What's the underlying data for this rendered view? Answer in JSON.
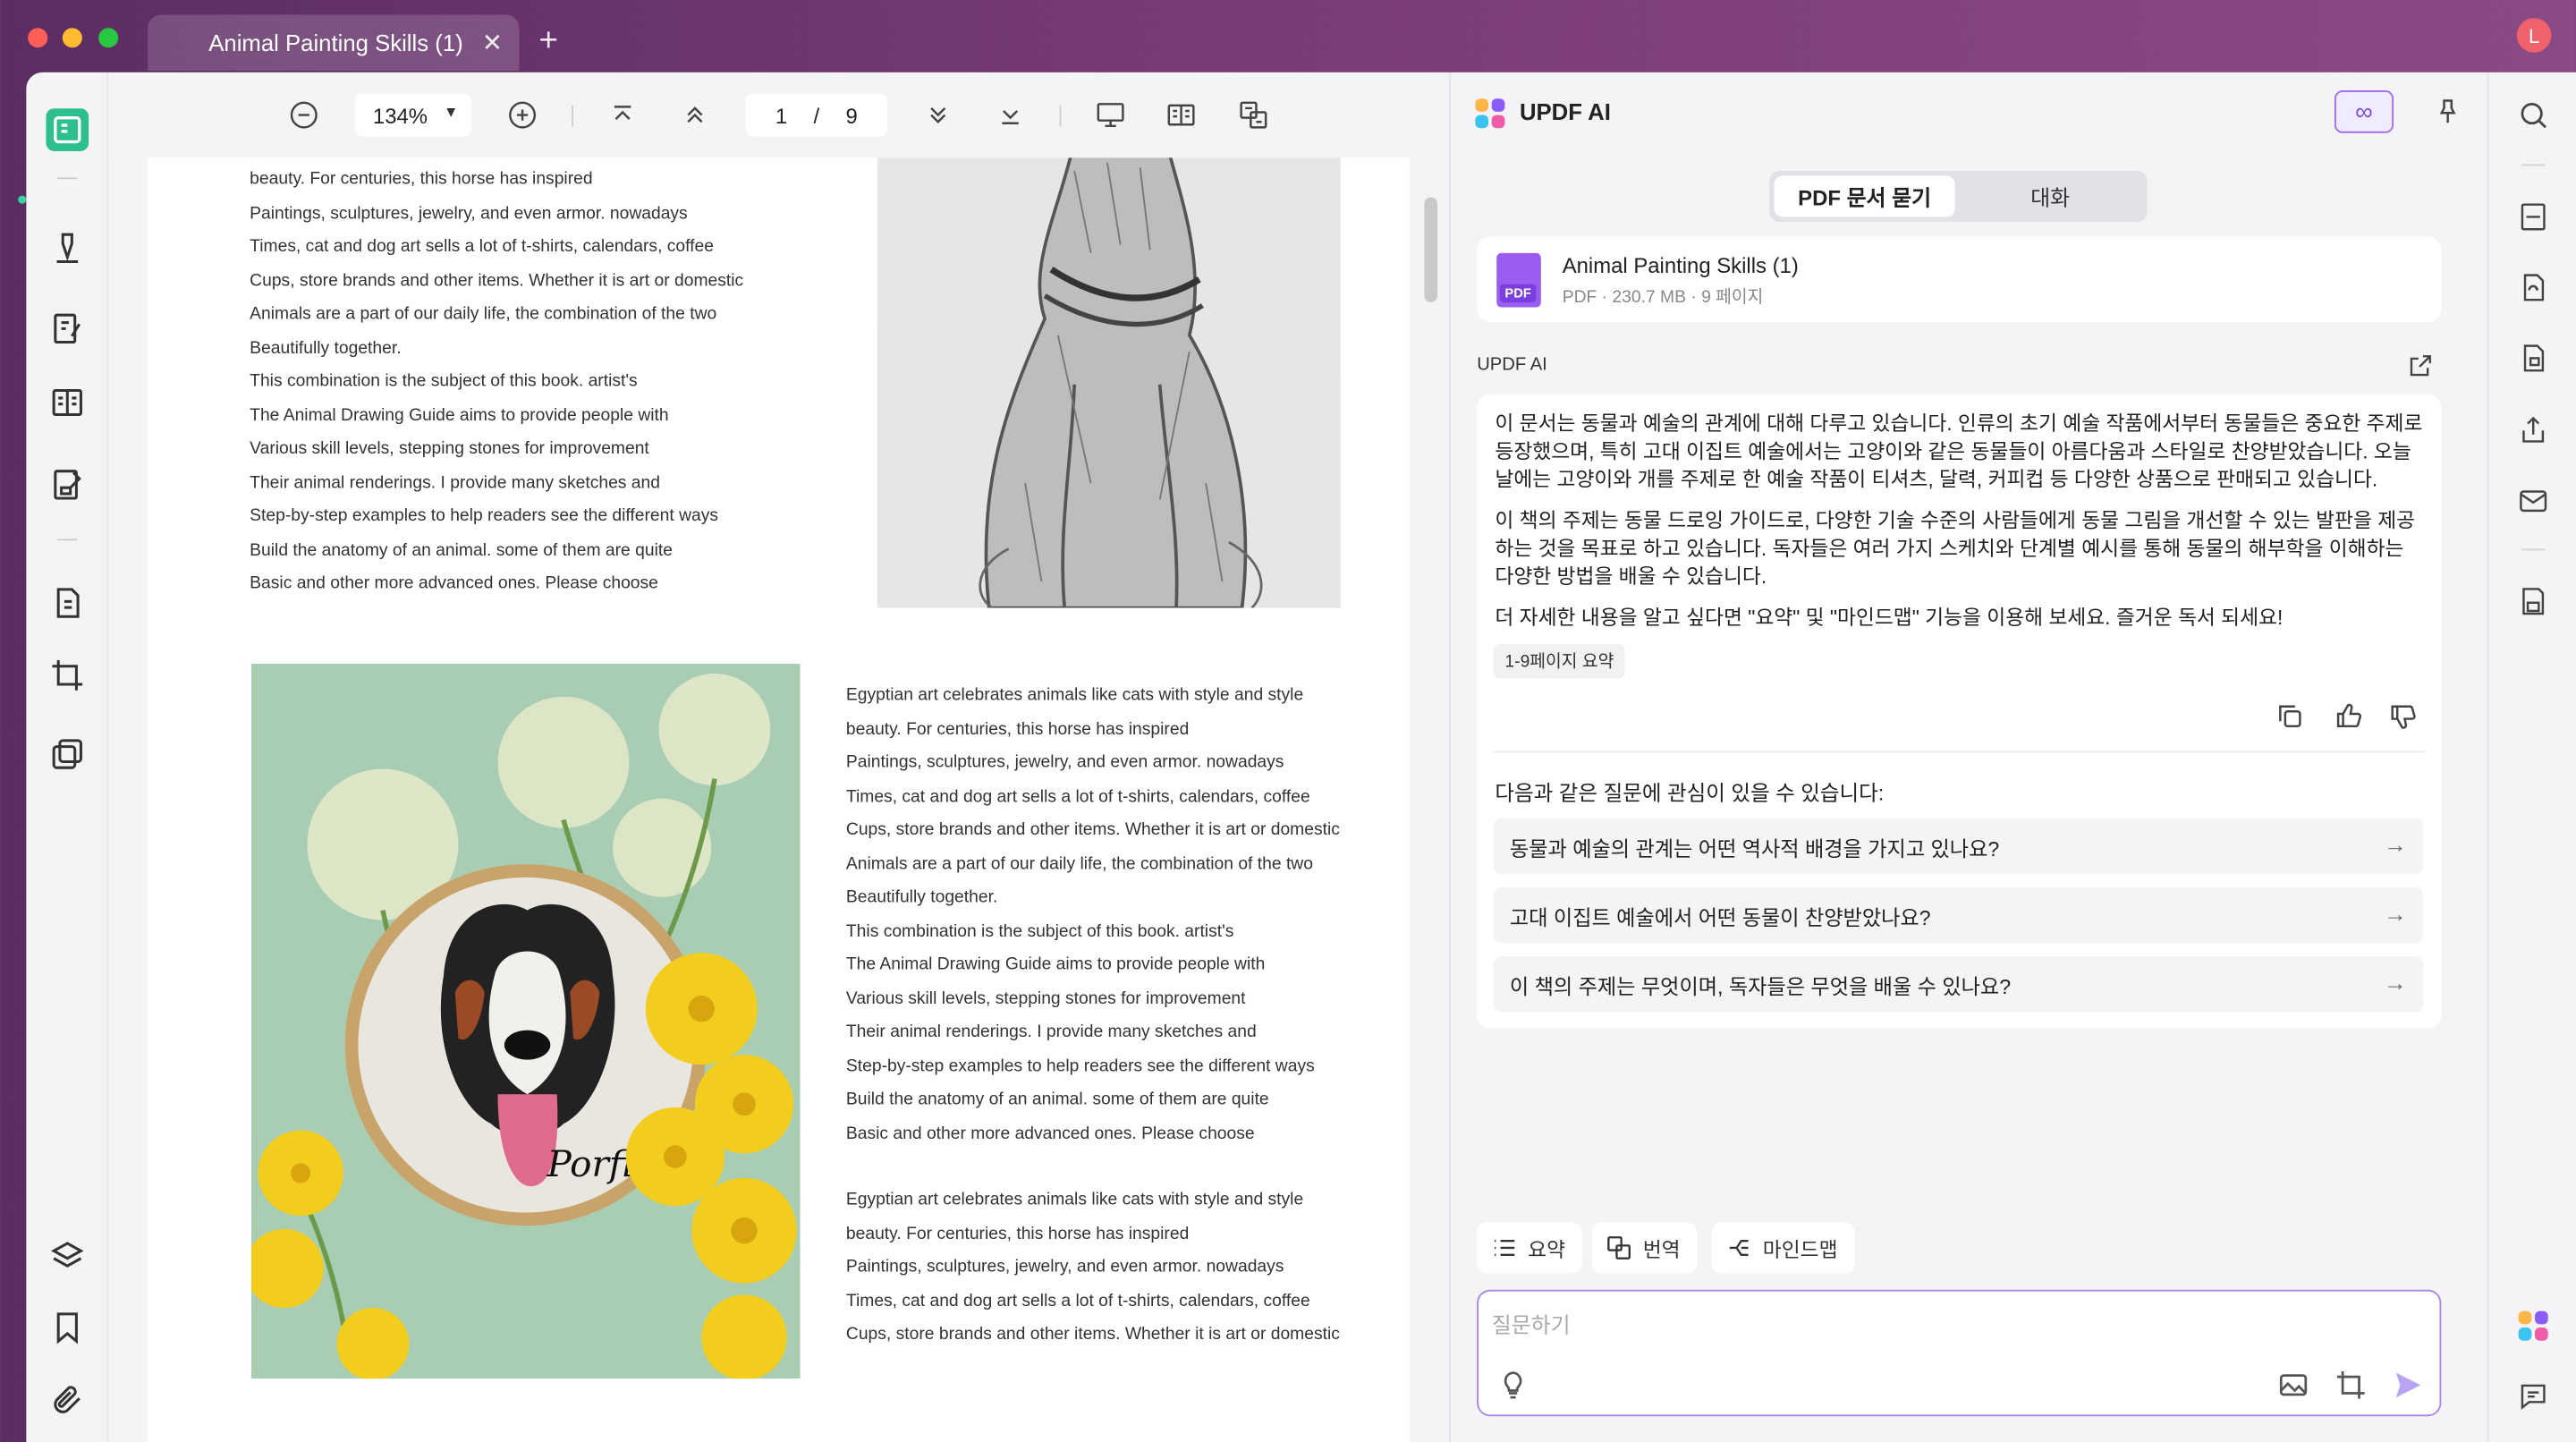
{
  "window": {
    "tab_title": "Animal Painting Skills (1)",
    "user_initial": "L"
  },
  "toolbar": {
    "zoom": "134%",
    "current_page": "1",
    "page_separator": "/",
    "total_pages": "9"
  },
  "document": {
    "top_text": [
      "beauty. For centuries, this horse has inspired",
      "Paintings, sculptures, jewelry, and even armor. nowadays",
      "Times, cat and dog art sells a lot of t-shirts, calendars, coffee",
      "Cups, store brands and other items. Whether it is art or domestic",
      "Animals are a part of our daily life, the combination of the two",
      "Beautifully together.",
      "This combination is the subject of this book. artist's",
      "The Animal Drawing Guide aims to provide people with",
      "Various skill levels, stepping stones for improvement",
      "Their animal renderings. I provide many sketches and",
      "Step-by-step examples to help readers see the different ways",
      "Build the anatomy of an animal. some of them are quite",
      "Basic and other more advanced ones. Please choose"
    ],
    "middle_text": [
      "Egyptian art celebrates animals like cats with style and style",
      "beauty. For centuries, this horse has inspired",
      "Paintings, sculptures, jewelry, and even armor. nowadays",
      "Times, cat and dog art sells a lot of t-shirts, calendars, coffee",
      "Cups, store brands and other items. Whether it is art or domestic",
      "Animals are a part of our daily life, the combination of the two",
      "Beautifully together.",
      "This combination is the subject of this book. artist's",
      "The Animal Drawing Guide aims to provide people with",
      "Various skill levels, stepping stones for improvement",
      "Their animal renderings. I provide many sketches and",
      "Step-by-step examples to help readers see the different ways",
      "Build the anatomy of an animal. some of them are quite",
      "Basic and other more advanced ones. Please choose"
    ],
    "bottom_text": [
      "Egyptian art celebrates animals like cats with style and style",
      "beauty. For centuries, this horse has inspired",
      "Paintings, sculptures, jewelry, and even armor. nowadays",
      "Times, cat and dog art sells a lot of t-shirts, calendars, coffee",
      "Cups, store brands and other items. Whether it is art or domestic"
    ],
    "photo_caption": "Porfirio"
  },
  "ai": {
    "title": "UPDF AI",
    "tabs": [
      "PDF 문서 묻기",
      "대화"
    ],
    "file_name": "Animal Painting Skills (1)",
    "file_meta": "PDF · 230.7 MB · 9 페이지",
    "file_badge": "PDF",
    "section_label": "UPDF AI",
    "answer_paragraphs": [
      "이 문서는 동물과 예술의 관계에 대해 다루고 있습니다. 인류의 초기 예술 작품에서부터 동물들은 중요한 주제로 등장했으며, 특히 고대 이집트 예술에서는 고양이와 같은 동물들이 아름다움과 스타일로 찬양받았습니다. 오늘날에는 고양이와 개를 주제로 한 예술 작품이 티셔츠, 달력, 커피컵 등 다양한 상품으로 판매되고 있습니다.",
      "이 책의 주제는 동물 드로잉 가이드로, 다양한 기술 수준의 사람들에게 동물 그림을 개선할 수 있는 발판을 제공하는 것을 목표로 하고 있습니다. 독자들은 여러 가지 스케치와 단계별 예시를 통해 동물의 해부학을 이해하는 다양한 방법을 배울 수 있습니다.",
      "더 자세한 내용을 알고 싶다면 \"요약\" 및 \"마인드맵\" 기능을 이용해 보세요. 즐거운 독서 되세요!"
    ],
    "page_chip": "1-9페이지 요약",
    "suggest_title": "다음과 같은 질문에 관심이 있을 수 있습니다:",
    "suggestions": [
      "동물과 예술의 관계는 어떤 역사적 배경을 가지고 있나요?",
      "고대 이집트 예술에서 어떤 동물이 찬양받았나요?",
      "이 책의 주제는 무엇이며, 독자들은 무엇을 배울 수 있나요?"
    ],
    "quick_actions": [
      "요약",
      "번역",
      "마인드맵"
    ],
    "input_placeholder": "질문하기",
    "accent_color": "#8b5cf6"
  }
}
